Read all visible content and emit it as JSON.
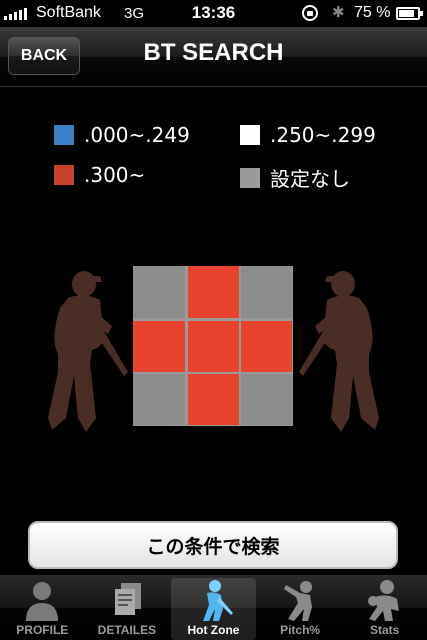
{
  "status_bar": {
    "carrier": "SoftBank",
    "network": "3G",
    "time": "13:36",
    "battery": "75 %",
    "battery_level": 0.75
  },
  "nav": {
    "back_label": "BACK",
    "title": "BT SEARCH"
  },
  "legend": [
    {
      "label": ".000~.249",
      "color": "#3b7fc4"
    },
    {
      "label": ".250~.299",
      "color": "#ffffff"
    },
    {
      "label": ".300~",
      "color": "#c8412f"
    },
    {
      "label": "設定なし",
      "color": "#9a9a9a"
    }
  ],
  "zone": {
    "cells": [
      [
        "none",
        "hot",
        "none"
      ],
      [
        "hot",
        "hot",
        "hot"
      ],
      [
        "none",
        "hot",
        "none"
      ]
    ],
    "colors": {
      "hot": "#e8432f",
      "none": "#8c8c8c"
    }
  },
  "search_button": "この条件で検索",
  "tabs": [
    {
      "label": "PROFILE",
      "icon": "person-icon",
      "active": false
    },
    {
      "label": "DETAILES",
      "icon": "documents-icon",
      "active": false
    },
    {
      "label": "Hot Zone",
      "icon": "batter-icon",
      "active": true
    },
    {
      "label": "Pitch%",
      "icon": "pitcher-icon",
      "active": false
    },
    {
      "label": "Stats",
      "icon": "catcher-icon",
      "active": false
    }
  ]
}
